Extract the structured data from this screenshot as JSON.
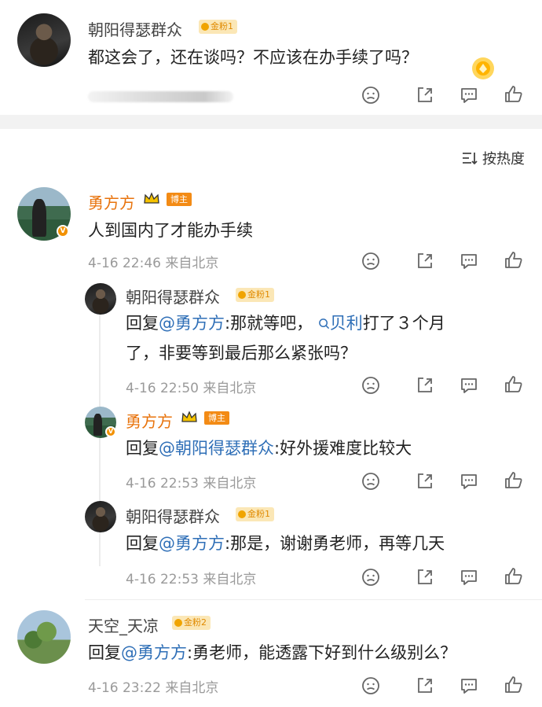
{
  "top_comment": {
    "user": "朝阳得瑟群众",
    "fan_badge": "金粉1",
    "text": "都这会了，还在谈吗？不应该在办手续了吗？"
  },
  "sort": {
    "label": "按热度"
  },
  "main_comment": {
    "user": "勇方方",
    "host_badge": "博主",
    "text": "人到国内了才能办手续",
    "meta": "4-16 22:46  来自北京"
  },
  "replies": [
    {
      "user": "朝阳得瑟群众",
      "fan_badge": "金粉1",
      "prefix": "回复",
      "mention": "@勇方方",
      "text_a": ":那就等吧，",
      "topic": "贝利",
      "text_b": "打了３个月",
      "text_line2": "了，非要等到最后那么紧张吗？",
      "meta": "4-16 22:50  来自北京"
    },
    {
      "user": "勇方方",
      "host_badge": "博主",
      "prefix": "回复",
      "mention": "@朝阳得瑟群众",
      "text": ":好外援难度比较大",
      "meta": "4-16 22:53  来自北京"
    },
    {
      "user": "朝阳得瑟群众",
      "fan_badge": "金粉1",
      "prefix": "回复",
      "mention": "@勇方方",
      "text": ":那是，谢谢勇老师，再等几天",
      "meta": "4-16 22:53  来自北京"
    }
  ],
  "last_comment": {
    "user": "天空_天凉",
    "fan_badge": "金粉2",
    "prefix": "回复",
    "mention": "@勇方方",
    "text": ":勇老师，能透露下好到什么级别么？",
    "meta": "4-16 23:22  来自北京"
  },
  "colors": {
    "accent_orange": "#e8730c",
    "mention_blue": "#2f6fb7",
    "meta_gray": "#9a9a9a"
  },
  "icons": [
    "dislike-icon",
    "share-icon",
    "comment-icon",
    "like-icon",
    "sort-icon",
    "search-icon",
    "crown-icon"
  ]
}
